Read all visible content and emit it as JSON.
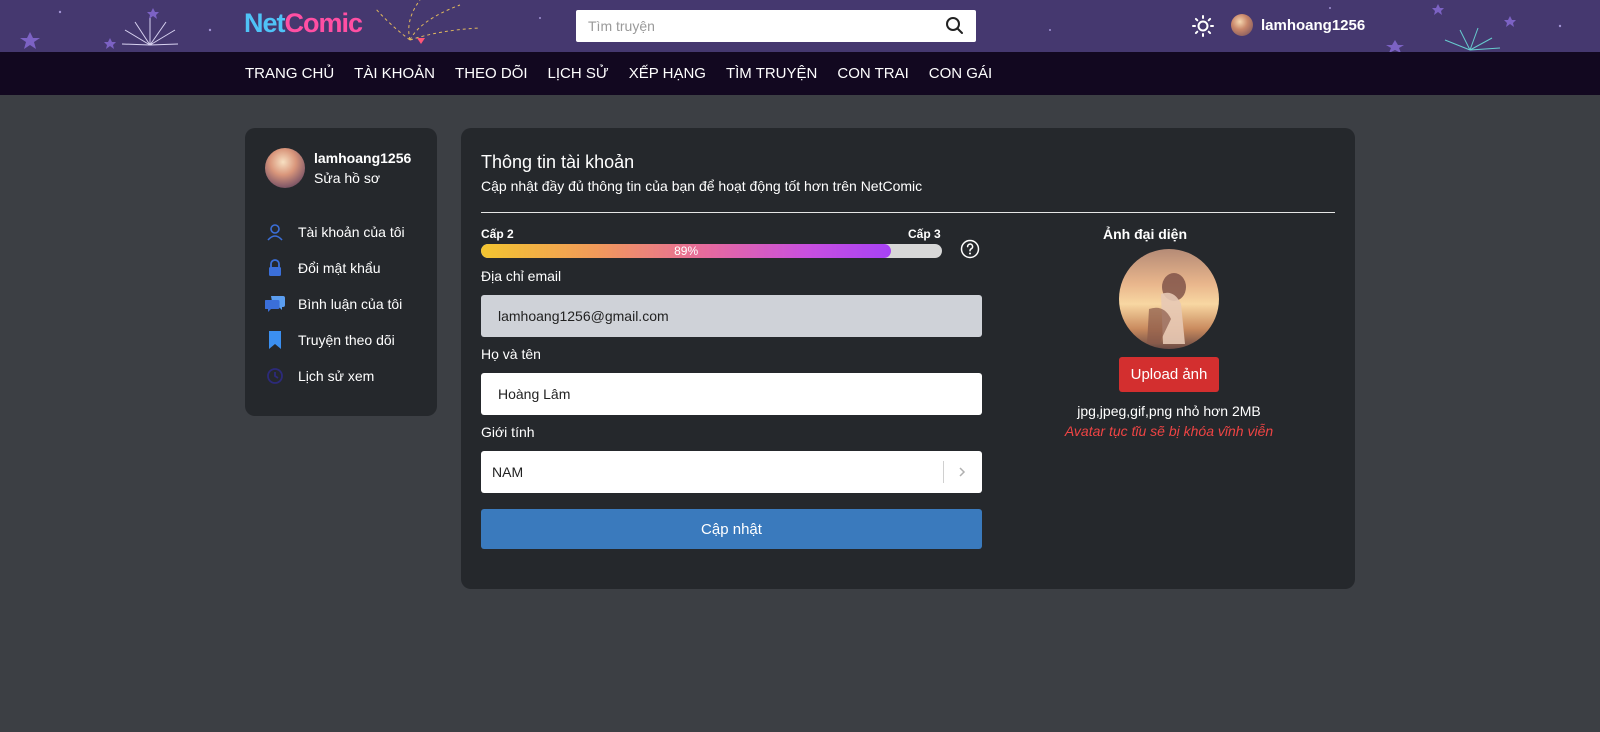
{
  "header": {
    "logo_part1": "Net",
    "logo_part2": "Comic",
    "search_placeholder": "Tìm truyện",
    "username": "lamhoang1256"
  },
  "nav": {
    "items": [
      "TRANG CHỦ",
      "TÀI KHOẢN",
      "THEO DÕI",
      "LỊCH SỬ",
      "XẾP HẠNG",
      "TÌM TRUYỆN",
      "CON TRAI",
      "CON GÁI"
    ]
  },
  "sidebar": {
    "username": "lamhoang1256",
    "edit_profile": "Sửa hồ sơ",
    "items": [
      {
        "label": "Tài khoản của tôi",
        "icon": "user-icon"
      },
      {
        "label": "Đổi mật khẩu",
        "icon": "lock-icon"
      },
      {
        "label": "Bình luận của tôi",
        "icon": "comment-icon"
      },
      {
        "label": "Truyện theo dõi",
        "icon": "bookmark-icon"
      },
      {
        "label": "Lịch sử xem",
        "icon": "history-icon"
      }
    ]
  },
  "account": {
    "title": "Thông tin tài khoản",
    "subtitle": "Cập nhật đầy đủ thông tin của bạn để hoạt động tốt hơn trên NetComic",
    "level_current": "Cấp 2",
    "level_next": "Cấp 3",
    "progress_percent": 89,
    "progress_label": "89%",
    "email_label": "Địa chỉ email",
    "email_value": "lamhoang1256@gmail.com",
    "name_label": "Họ và tên",
    "name_value": "Hoàng Lâm",
    "gender_label": "Giới tính",
    "gender_value": "NAM",
    "update_button": "Cập nhật",
    "avatar_title": "Ảnh đại diện",
    "upload_button": "Upload ảnh",
    "avatar_note": "jpg,jpeg,gif,png nhỏ hơn 2MB",
    "avatar_warning": "Avatar tục tĩu sẽ bị khóa vĩnh viễn"
  },
  "colors": {
    "header_bg": "#45386f",
    "nav_bg": "#120820",
    "panel_bg": "#25282c",
    "page_bg": "#3c3f44",
    "primary": "#3a7abd",
    "danger": "#d32f2f",
    "warning_text": "#ef4444"
  }
}
